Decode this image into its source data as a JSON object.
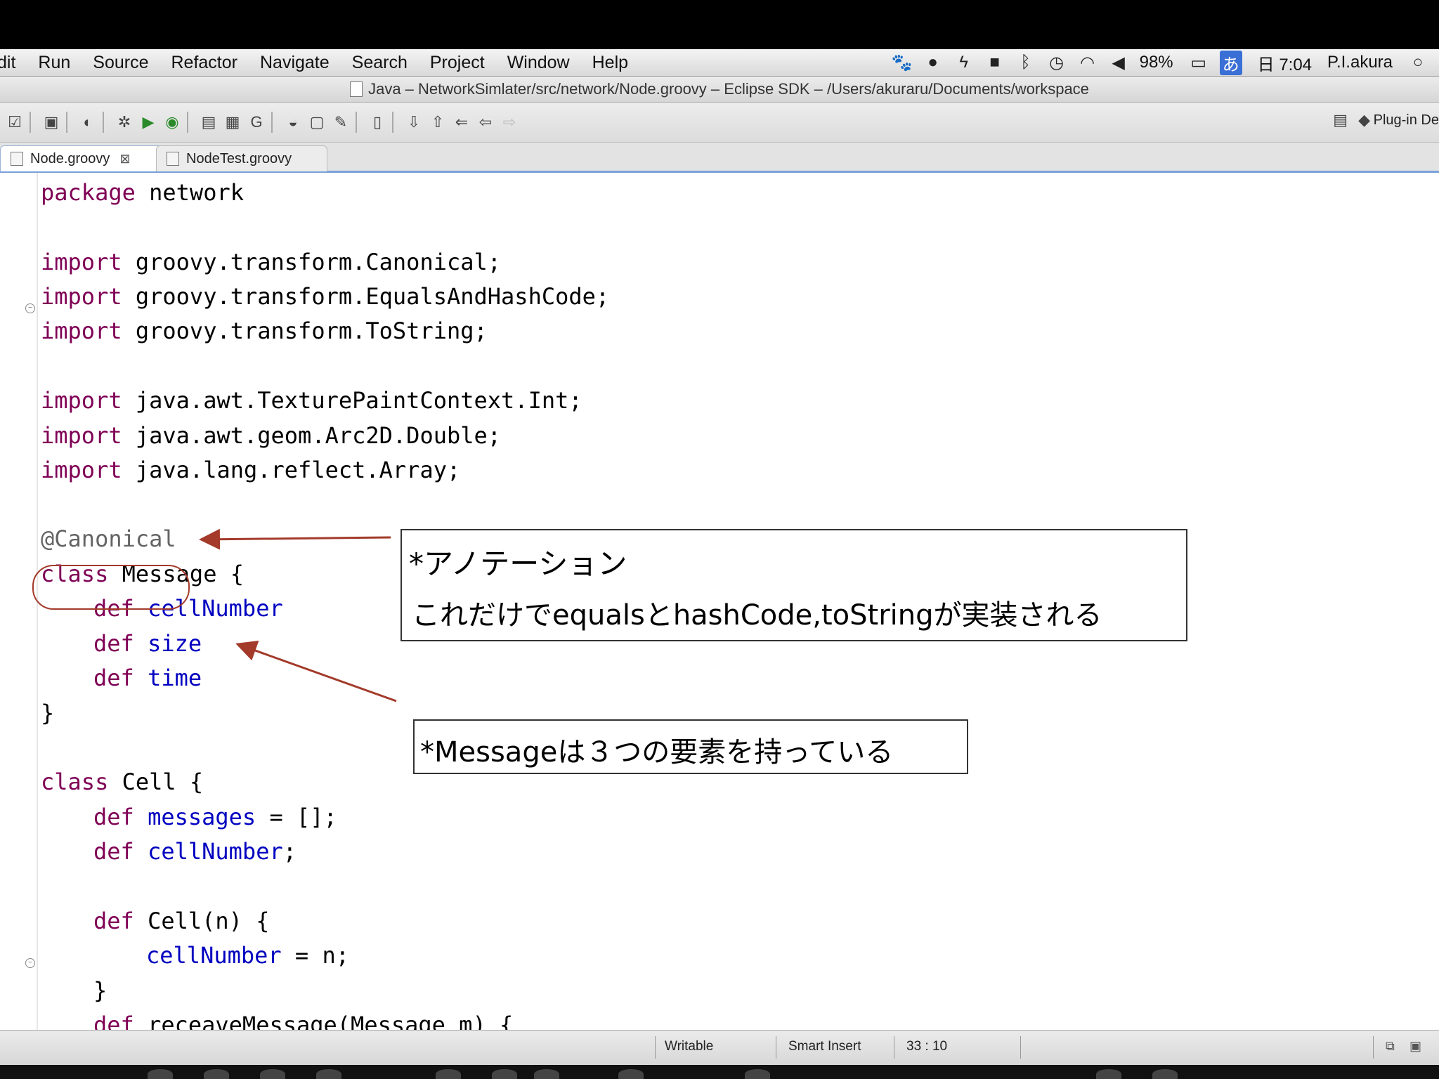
{
  "menubar": {
    "items": [
      "dit",
      "Run",
      "Source",
      "Refactor",
      "Navigate",
      "Search",
      "Project",
      "Window",
      "Help"
    ],
    "battery": "98%",
    "input_method": "あ",
    "clock": "日 7:04",
    "user": "P.I.akura"
  },
  "titlebar": {
    "title": "Java – NetworkSimlater/src/network/Node.groovy – Eclipse SDK – /Users/akuraru/Documents/workspace"
  },
  "toolbar": {
    "perspective_label": "Plug-in De"
  },
  "tabs": [
    {
      "label": "Node.groovy",
      "close": "⊠",
      "active": true
    },
    {
      "label": "NodeTest.groovy",
      "active": false
    }
  ],
  "code": {
    "lines": [
      {
        "kw": "package",
        "rest": " network"
      },
      {
        "kw": "import",
        "rest": " groovy.transform.Canonical;"
      },
      {
        "kw": "import",
        "rest": " groovy.transform.EqualsAndHashCode;"
      },
      {
        "kw": "import",
        "rest": " groovy.transform.ToString;"
      },
      {
        "kw": "import",
        "rest": " java.awt.TexturePaintContext.Int;"
      },
      {
        "kw": "import",
        "rest": " java.awt.geom.Arc2D.Double;"
      },
      {
        "kw": "import",
        "rest": " java.lang.reflect.Array;"
      },
      {
        "ann": "@Canonical"
      },
      {
        "kw": "class",
        "rest": " Message {"
      },
      {
        "kw": "def",
        "fld": "cellNumber"
      },
      {
        "kw": "def",
        "fld": "size"
      },
      {
        "kw": "def",
        "fld": "time"
      },
      {
        "rest": "}"
      },
      {
        "kw": "class",
        "rest": " Cell {"
      },
      {
        "kw": "def",
        "fld": "messages",
        "rest": " = [];"
      },
      {
        "kw": "def",
        "fld": "cellNumber",
        "rest": ";"
      },
      {
        "kw": "def",
        "rest": " Cell(n) {"
      },
      {
        "fld": "cellNumber",
        "rest": " = n;"
      },
      {
        "rest": "}"
      },
      {
        "kw": "def",
        "rest": " receaveMessage(Message m) {"
      }
    ]
  },
  "callouts": {
    "annotation_title": "*アノテーション",
    "annotation_body": "これだけでequalsとhashCode,toStringが実装される",
    "message_note": "*Messageは３つの要素を持っている"
  },
  "statusbar": {
    "writable": "Writable",
    "insert_mode": "Smart Insert",
    "position": "33 : 10"
  }
}
